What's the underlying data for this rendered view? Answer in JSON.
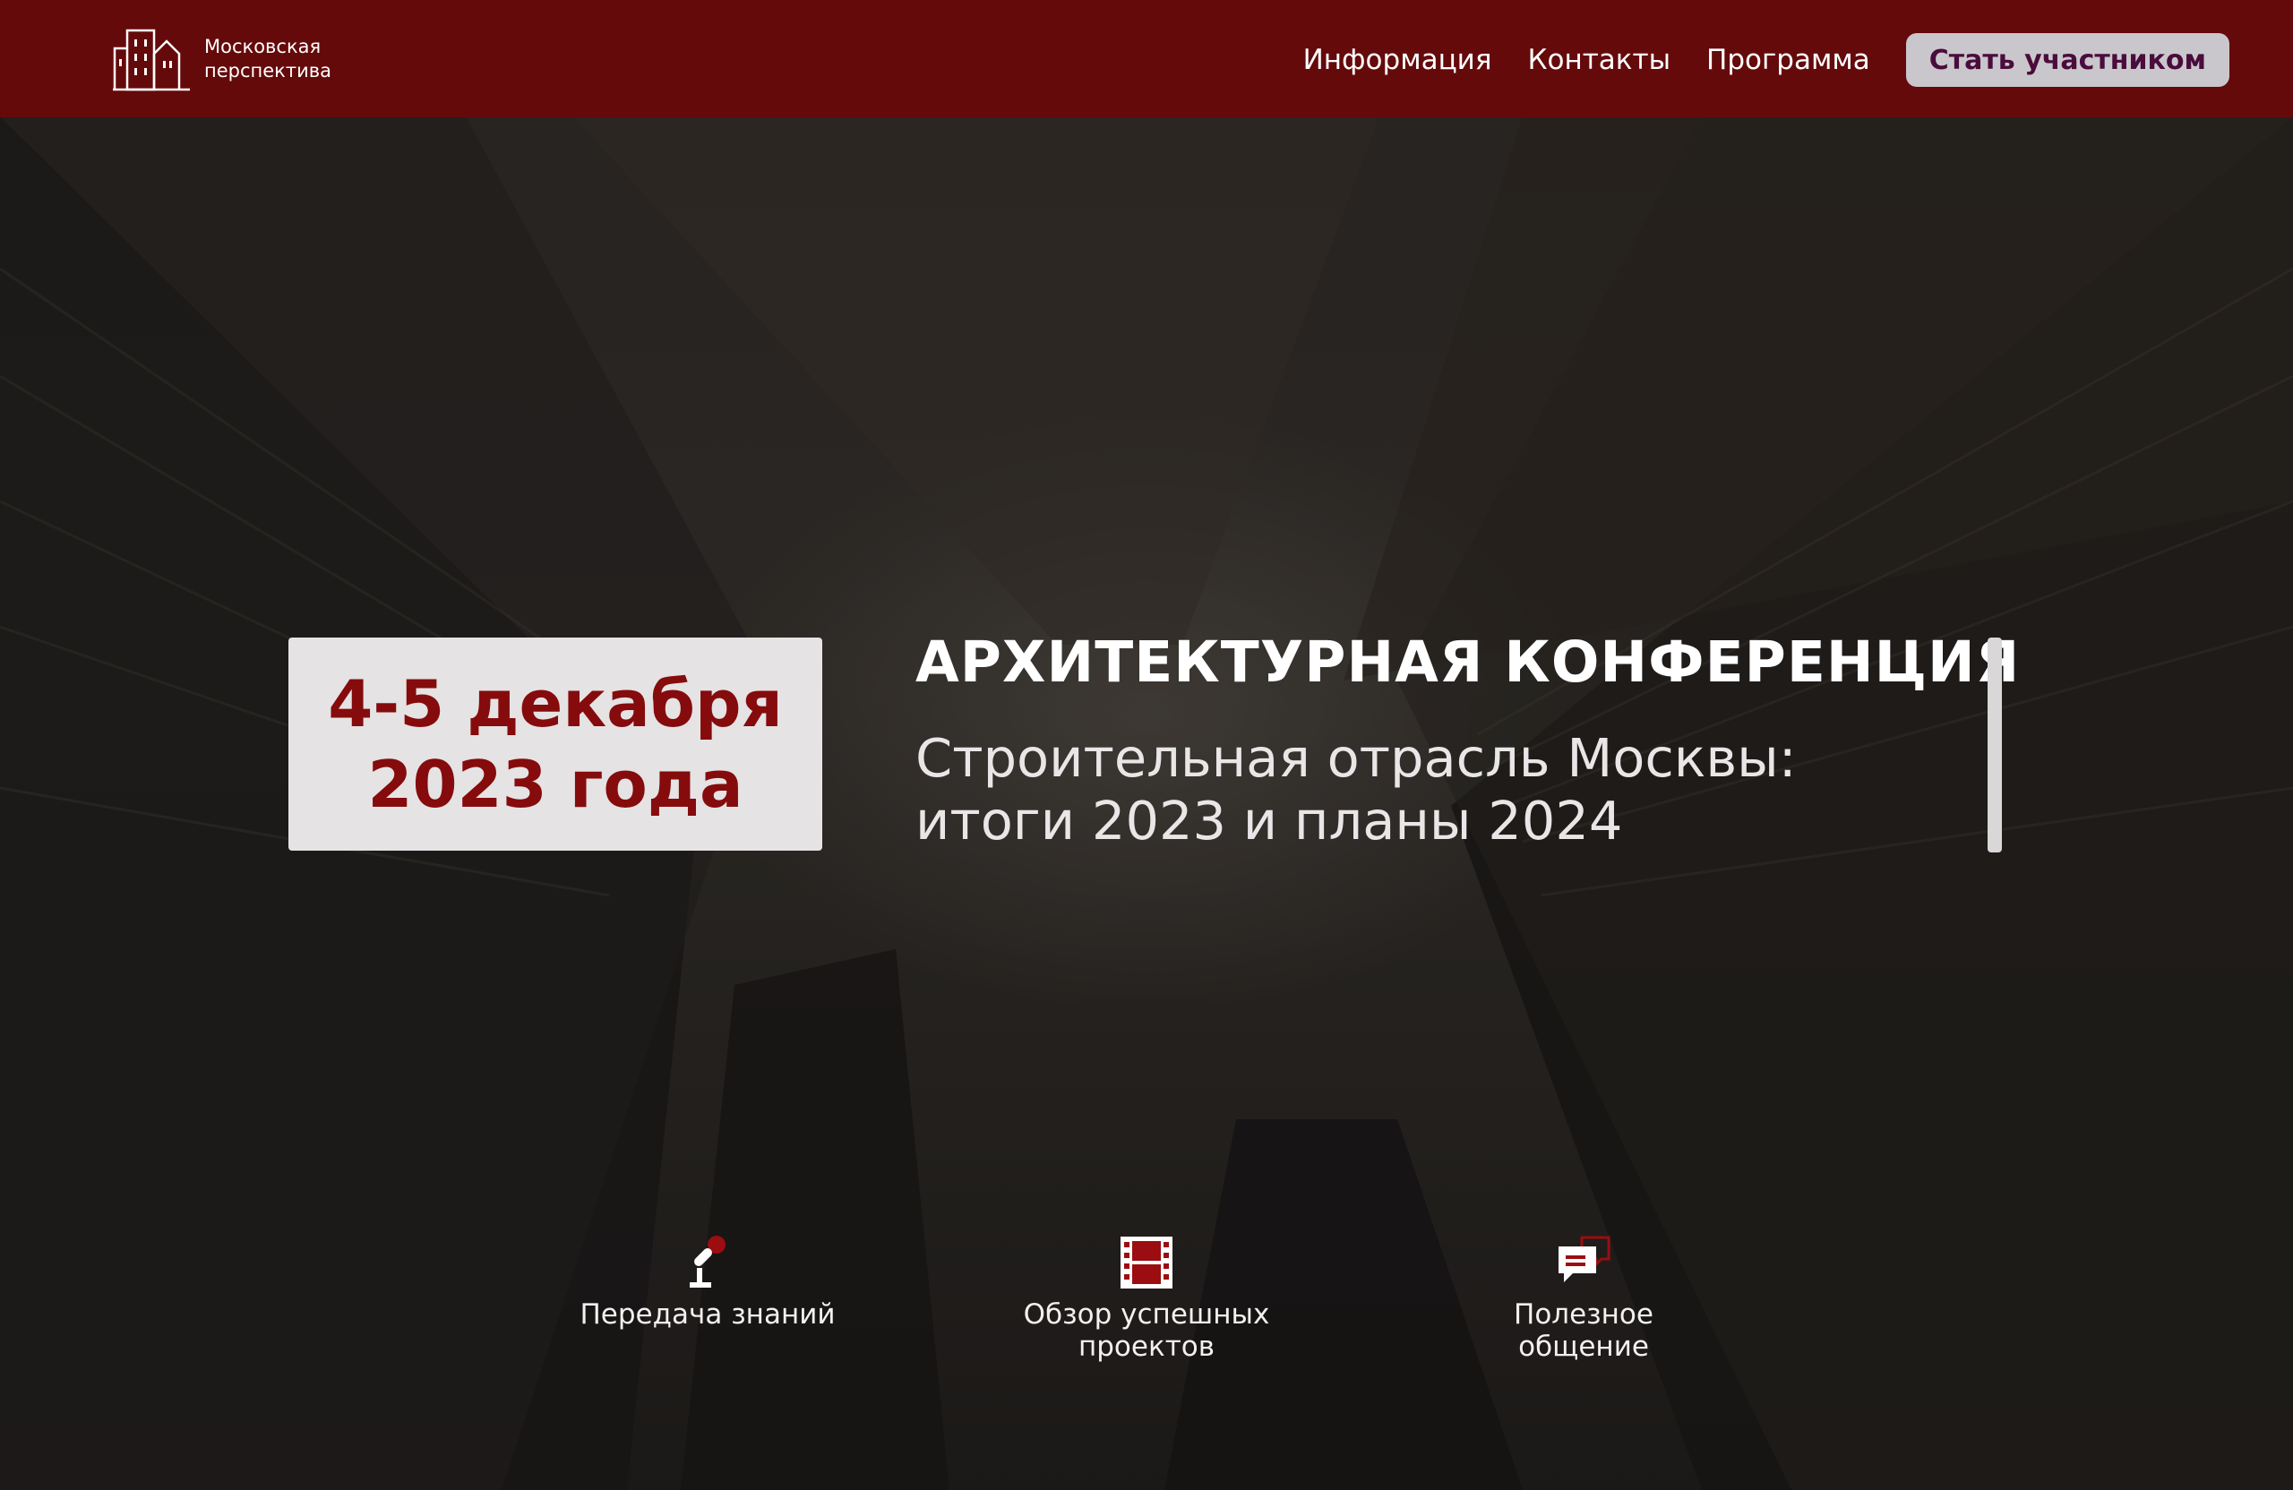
{
  "header": {
    "logo": {
      "icon": "buildings-logo-icon",
      "line1": "Московская",
      "line2": "перспектива"
    },
    "nav": [
      {
        "label": "Информация"
      },
      {
        "label": "Контакты"
      },
      {
        "label": "Программа"
      }
    ],
    "cta_label": "Стать участником"
  },
  "hero": {
    "date_line1": "4-5 декабря",
    "date_line2": "2023 года",
    "title": "АРХИТЕКТУРНАЯ КОНФЕРЕНЦИЯ",
    "subtitle_line1": "Строительная отрасль Москвы:",
    "subtitle_line2": "итоги 2023 и планы 2024"
  },
  "features": [
    {
      "icon": "microphone-icon",
      "line1": "Передача знаний",
      "line2": ""
    },
    {
      "icon": "film-icon",
      "line1": "Обзор успешных",
      "line2": "проектов"
    },
    {
      "icon": "chat-icon",
      "line1": "Полезное",
      "line2": "общение"
    }
  ],
  "colors": {
    "header_bg": "#650a0b",
    "accent_red": "#850b0d",
    "cta_bg": "#c9c7cb",
    "cta_text": "#4a0c3c"
  }
}
